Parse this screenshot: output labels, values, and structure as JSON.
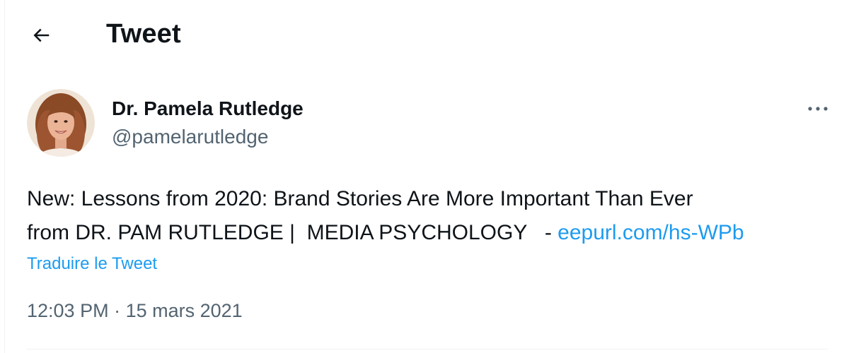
{
  "header": {
    "title": "Tweet",
    "back_icon": "arrow-left-icon"
  },
  "author": {
    "display_name": "Dr. Pamela Rutledge",
    "handle": "@pamelarutledge",
    "avatar_icon": "profile-photo"
  },
  "tweet": {
    "text_line1": "New: Lessons from 2020: Brand Stories Are More Important Than Ever",
    "text_line2": "from DR. PAM RUTLEDGE |  MEDIA PSYCHOLOGY   - ",
    "link": "eepurl.com/hs-WPb",
    "translate_label": "Traduire le Tweet",
    "time": "12:03 PM",
    "separator": " · ",
    "date": "15 mars 2021"
  },
  "colors": {
    "link": "#1d9bf0",
    "secondary_text": "#536471",
    "primary_text": "#0f1419"
  }
}
